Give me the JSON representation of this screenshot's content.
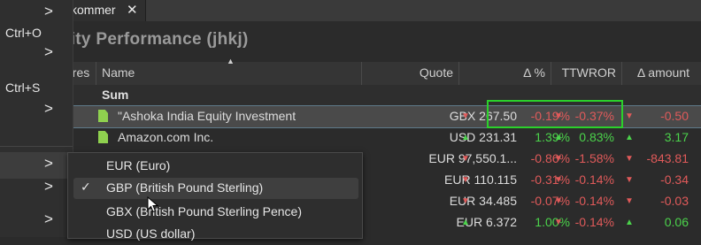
{
  "tab": {
    "label": "kommer",
    "close": "✕"
  },
  "title": "rity Performance (jhkj)",
  "columns": {
    "shares": "ares",
    "name": "Name",
    "quote": "Quote",
    "delta_pct": "Δ %",
    "ttwror": "TTWROR",
    "delta_amount": "Δ amount"
  },
  "sum_label": "Sum",
  "rows": [
    {
      "name": "\"Ashoka India Equity Investment",
      "quote": "GBX 267.50",
      "delta_pct": "-0.19%",
      "ttwror": "-0.37%",
      "delta_amount": "-0.50",
      "dir1": "▼",
      "dir2": "▼",
      "dir3": "▼",
      "c1": "down",
      "c2": "down",
      "c3": "down"
    },
    {
      "name": "Amazon.com Inc.",
      "quote": "USD 231.31",
      "delta_pct": "1.39%",
      "ttwror": "0.83%",
      "delta_amount": "3.17",
      "dir1": "▲",
      "dir2": "▲",
      "dir3": "▲",
      "c1": "up",
      "c2": "up",
      "c3": "up"
    },
    {
      "name": "",
      "quote": "EUR 97,550.1...",
      "delta_pct": "-0.86%",
      "ttwror": "-1.58%",
      "delta_amount": "-843.81",
      "dir1": "▼",
      "dir2": "▼",
      "dir3": "▼",
      "c1": "down",
      "c2": "down",
      "c3": "down"
    },
    {
      "name": "",
      "quote": "EUR 110.115",
      "delta_pct": "-0.31%",
      "ttwror": "-0.14%",
      "delta_amount": "-0.34",
      "dir1": "▼",
      "dir2": "▼",
      "dir3": "▼",
      "c1": "down",
      "c2": "down",
      "c3": "down"
    },
    {
      "name": "",
      "quote": "EUR 34.485",
      "delta_pct": "-0.07%",
      "ttwror": "-0.14%",
      "delta_amount": "-0.03",
      "dir1": "▼",
      "dir2": "▼",
      "dir3": "▼",
      "c1": "down",
      "c2": "down",
      "c3": "down"
    },
    {
      "name": "",
      "quote": "EUR 6.372",
      "delta_pct": "1.00%",
      "ttwror": "-0.14%",
      "delta_amount": "0.06",
      "dir1": "▲",
      "dir2": "▼",
      "dir3": "▲",
      "c1": "up",
      "c2": "down",
      "c3": "up"
    }
  ],
  "left_menu": [
    {
      "label": "",
      "chevron": ">"
    },
    {
      "label": "Ctrl+O",
      "chevron": ""
    },
    {
      "label": "",
      "chevron": ">"
    },
    {
      "label": "Ctrl+S",
      "chevron": ""
    },
    {
      "label": "",
      "chevron": ">"
    },
    {
      "label": "",
      "chevron": ">"
    },
    {
      "label": "",
      "chevron": ">"
    },
    {
      "label": "",
      "chevron": ">"
    }
  ],
  "currency_menu": [
    {
      "label": "EUR (Euro)",
      "checked": ""
    },
    {
      "label": "GBP (British Pound Sterling)",
      "checked": "✓"
    },
    {
      "label": "GBX (British Pound Sterling Pence)",
      "checked": ""
    },
    {
      "label": "USD (US dollar)",
      "checked": ""
    }
  ],
  "colors": {
    "positive": "#4bd34b",
    "negative": "#e05a5a",
    "highlight": "#2bd12b"
  }
}
